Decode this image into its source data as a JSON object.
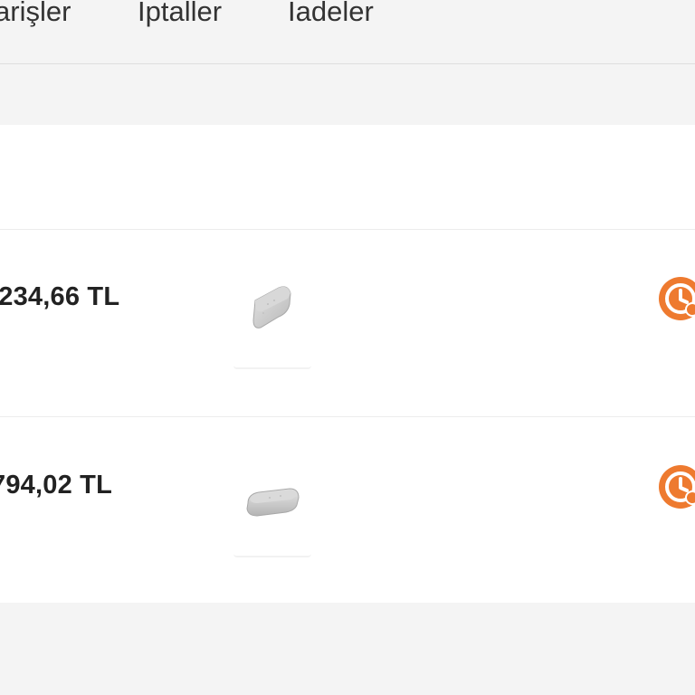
{
  "tabs": [
    {
      "label": "arişler"
    },
    {
      "label": "İptaller"
    },
    {
      "label": "İadeler"
    }
  ],
  "orders": [
    {
      "price": ".234,66 TL",
      "product_icon": "gray-soap-bar-icon",
      "status_icon": "orange-clock-status-icon"
    },
    {
      "price": "794,02 TL",
      "product_icon": "gray-soap-bar-icon",
      "status_icon": "orange-clock-status-icon"
    }
  ],
  "colors": {
    "accent": "#ee7a2f",
    "background": "#f4f4f4",
    "card": "#ffffff",
    "text": "#222222"
  }
}
